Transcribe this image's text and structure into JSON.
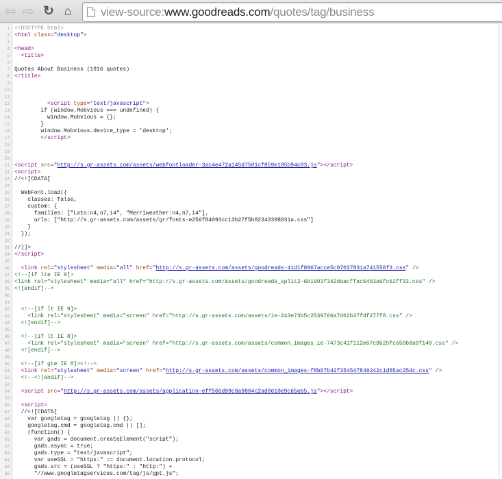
{
  "browser": {
    "url_scheme": "view-source:",
    "url_host": "www.goodreads.com",
    "url_path": "/quotes/tag/business",
    "icons": [
      "back-icon",
      "forward-icon",
      "reload-icon",
      "home-icon",
      "page-icon"
    ]
  },
  "source": {
    "start_line": 1,
    "lines": [
      [
        [
          "doctype",
          "<!DOCTYPE html>"
        ]
      ],
      [
        [
          "tag",
          "<html "
        ],
        [
          "attr",
          "class"
        ],
        [
          "tag",
          "=\""
        ],
        [
          "val",
          "desktop"
        ],
        [
          "tag",
          "\">"
        ]
      ],
      [],
      [
        [
          "tag",
          "<head>"
        ]
      ],
      [
        [
          "text",
          "  "
        ],
        [
          "tag",
          "<title>"
        ]
      ],
      [],
      [
        [
          "text",
          "Quotes About Business (1916 quotes)"
        ]
      ],
      [
        [
          "tag",
          "</title>"
        ]
      ],
      [],
      [],
      [],
      [
        [
          "text",
          "          "
        ],
        [
          "tag",
          "<script "
        ],
        [
          "attr",
          "type"
        ],
        [
          "tag",
          "=\""
        ],
        [
          "val",
          "text/javascript"
        ],
        [
          "tag",
          "\">"
        ]
      ],
      [
        [
          "text",
          "        if (window.Mobvious === undefined) {"
        ]
      ],
      [
        [
          "text",
          "          window.Mobvious = {};"
        ]
      ],
      [
        [
          "text",
          "        }"
        ]
      ],
      [
        [
          "text",
          "        window.Mobvious.device_type = 'desktop';"
        ]
      ],
      [
        [
          "text",
          "        "
        ],
        [
          "tag",
          "</script>"
        ]
      ],
      [],
      [],
      [],
      [
        [
          "tag",
          "<script "
        ],
        [
          "attr",
          "src"
        ],
        [
          "tag",
          "=\""
        ],
        [
          "link",
          "http://s.gr-assets.com/assets/webfontloader-3ac4e472a145d7501cf859e105b94c83.js"
        ],
        [
          "tag",
          "\"></script>"
        ]
      ],
      [
        [
          "tag",
          "<script>"
        ]
      ],
      [
        [
          "text",
          "//<![CDATA["
        ]
      ],
      [],
      [
        [
          "text",
          "  WebFont.load({"
        ]
      ],
      [
        [
          "text",
          "    classes: false,"
        ]
      ],
      [
        [
          "text",
          "    custom: {"
        ]
      ],
      [
        [
          "text",
          "      families: [\"Lato:n4,n7,i4\", \"Merriweather:n4,n7,i4\"],"
        ]
      ],
      [
        [
          "text",
          "      urls: [\"http://s.gr-assets.com/assets/gr/fonts-e256f84093cc13b27f5b82343398031a.css\"]"
        ]
      ],
      [
        [
          "text",
          "    }"
        ]
      ],
      [
        [
          "text",
          "  });"
        ]
      ],
      [],
      [
        [
          "text",
          "//]]>"
        ]
      ],
      [
        [
          "tag",
          "</script>"
        ]
      ],
      [],
      [
        [
          "text",
          "  "
        ],
        [
          "tag",
          "<link "
        ],
        [
          "attr",
          "rel"
        ],
        [
          "tag",
          "=\""
        ],
        [
          "val",
          "stylesheet"
        ],
        [
          "tag",
          "\" "
        ],
        [
          "attr",
          "media"
        ],
        [
          "tag",
          "=\""
        ],
        [
          "val",
          "all"
        ],
        [
          "tag",
          "\" "
        ],
        [
          "attr",
          "href"
        ],
        [
          "tag",
          "=\""
        ],
        [
          "link",
          "http://s.gr-assets.com/assets/goodreads-41d1f8967acce5c07037831a741550f3.css"
        ],
        [
          "tag",
          "\" />"
        ]
      ],
      [
        [
          "comment",
          "<!--[if lte IE 9]>"
        ]
      ],
      [
        [
          "comment",
          "<link rel=\"stylesheet\" media=\"all\" href=\"http://s.gr-assets.com/assets/goodreads_split2-6b1993f342daacffac64b3a6fc62ff33.css\" />"
        ]
      ],
      [
        [
          "comment",
          "<![endif]-->"
        ]
      ],
      [],
      [],
      [
        [
          "text",
          "  "
        ],
        [
          "comment",
          "<!--[if lt IE 9]>"
        ]
      ],
      [
        [
          "comment",
          "    <link rel=\"stylesheet\" media=\"screen\" href=\"http://s.gr-assets.com/assets/ie-243e73b5c2539766a7d02b37fdf277f8.css\" />"
        ]
      ],
      [
        [
          "comment",
          "  <![endif]-->"
        ]
      ],
      [],
      [
        [
          "text",
          "  "
        ],
        [
          "comment",
          "<!--[if lt IE 8]>"
        ]
      ],
      [
        [
          "comment",
          "    <link rel=\"stylesheet\" media=\"screen\" href=\"http://s.gr-assets.com/assets/common_images_ie-7473c41f112e67c8b25fca50b8a0f140.css\" />"
        ]
      ],
      [
        [
          "comment",
          "  <![endif]-->"
        ]
      ],
      [],
      [
        [
          "text",
          "  "
        ],
        [
          "comment",
          "<!--[if gte IE 8]><!-->"
        ]
      ],
      [
        [
          "text",
          "  "
        ],
        [
          "tag",
          "<link "
        ],
        [
          "attr",
          "rel"
        ],
        [
          "tag",
          "=\""
        ],
        [
          "val",
          "stylesheet"
        ],
        [
          "tag",
          "\" "
        ],
        [
          "attr",
          "media"
        ],
        [
          "tag",
          "=\""
        ],
        [
          "val",
          "screen"
        ],
        [
          "tag",
          "\" "
        ],
        [
          "attr",
          "href"
        ],
        [
          "tag",
          "=\""
        ],
        [
          "link",
          "http://s.gr-assets.com/assets/common_images-f8b07b42f354547849242c1d85ac25dc.css"
        ],
        [
          "tag",
          "\" />"
        ]
      ],
      [
        [
          "text",
          "  "
        ],
        [
          "comment",
          "<!--<![endif]-->"
        ]
      ],
      [],
      [
        [
          "text",
          "  "
        ],
        [
          "tag",
          "<script "
        ],
        [
          "attr",
          "src"
        ],
        [
          "tag",
          "=\""
        ],
        [
          "link",
          "http://s.gr-assets.com/assets/application-eff566d99c8a9804c2ad8610e9c65eb5.js"
        ],
        [
          "tag",
          "\"></script>"
        ]
      ],
      [],
      [
        [
          "text",
          "  "
        ],
        [
          "tag",
          "<script>"
        ]
      ],
      [
        [
          "text",
          "  //<![CDATA["
        ]
      ],
      [
        [
          "text",
          "    var googletag = googletag || {};"
        ]
      ],
      [
        [
          "text",
          "    googletag.cmd = googletag.cmd || [];"
        ]
      ],
      [
        [
          "text",
          "    (function() {"
        ]
      ],
      [
        [
          "text",
          "      var gads = document.createElement(\"script\");"
        ]
      ],
      [
        [
          "text",
          "      gads.async = true;"
        ]
      ],
      [
        [
          "text",
          "      gads.type = \"text/javascript\";"
        ]
      ],
      [
        [
          "text",
          "      var useSSL = \"https:\" == document.location.protocol;"
        ]
      ],
      [
        [
          "text",
          "      gads.src = (useSSL ? \"https:\" : \"http:\") +"
        ]
      ],
      [
        [
          "text",
          "      \"//www.googletagservices.com/tag/js/gpt.js\";"
        ]
      ]
    ]
  }
}
